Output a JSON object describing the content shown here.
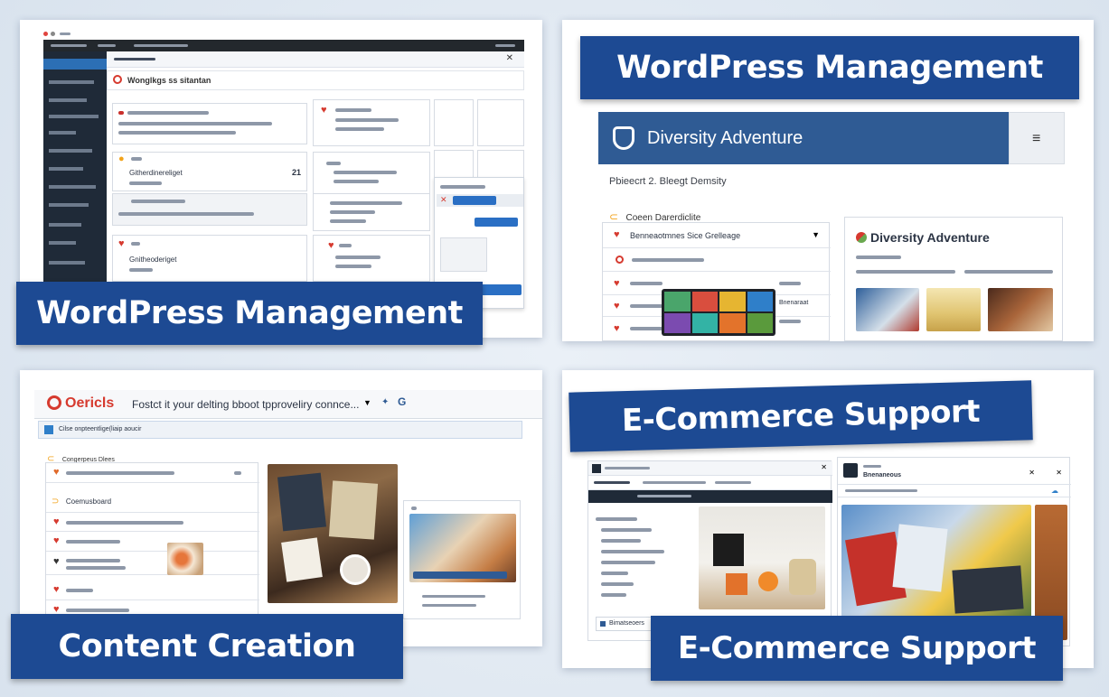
{
  "banners": {
    "top_left": "WordPress Management",
    "top_right": "WordPress Management",
    "bottom_left": "Content Creation",
    "bottom_right_top": "E-Commerce Support",
    "bottom_right_bottom": "E-Commerce Support"
  },
  "panel1": {
    "page_heading": "Wonglkgs ss sitantan",
    "item_title_1": "Githerdinereliget",
    "item_title_2": "Gnitheoderiget",
    "count": "21"
  },
  "panel2": {
    "site_name": "Diversity Adventure",
    "subtitle": "Pbieecrt 2. Bleegt Demsity",
    "section_label": "Coeen Darerdiclite",
    "row_1": "Benneaotmnes Sice Grelleage",
    "card_title": "Diversity Adventure",
    "card_row_action": "Bnenaraat"
  },
  "panel3": {
    "brand": "Oericls",
    "search_text": "Fostct it your delting bboot tpproveliry connce...",
    "sub_bar_text": "Cilse onpteentlige(liaip aoucir",
    "section_label": "Congerpeus Dlees",
    "item_heading": "Coemusboard"
  },
  "panel4": {
    "tab_label": "Bimatseoers",
    "button_label": "Bnenaneous"
  },
  "colors": {
    "banner_blue": "#1d4a93",
    "accent_red": "#d63a2f",
    "site_header_blue": "#2f5b94"
  },
  "icons": {
    "menu": "hamburger-icon",
    "logo": "shield-logo-icon",
    "heart": "heart-icon"
  }
}
